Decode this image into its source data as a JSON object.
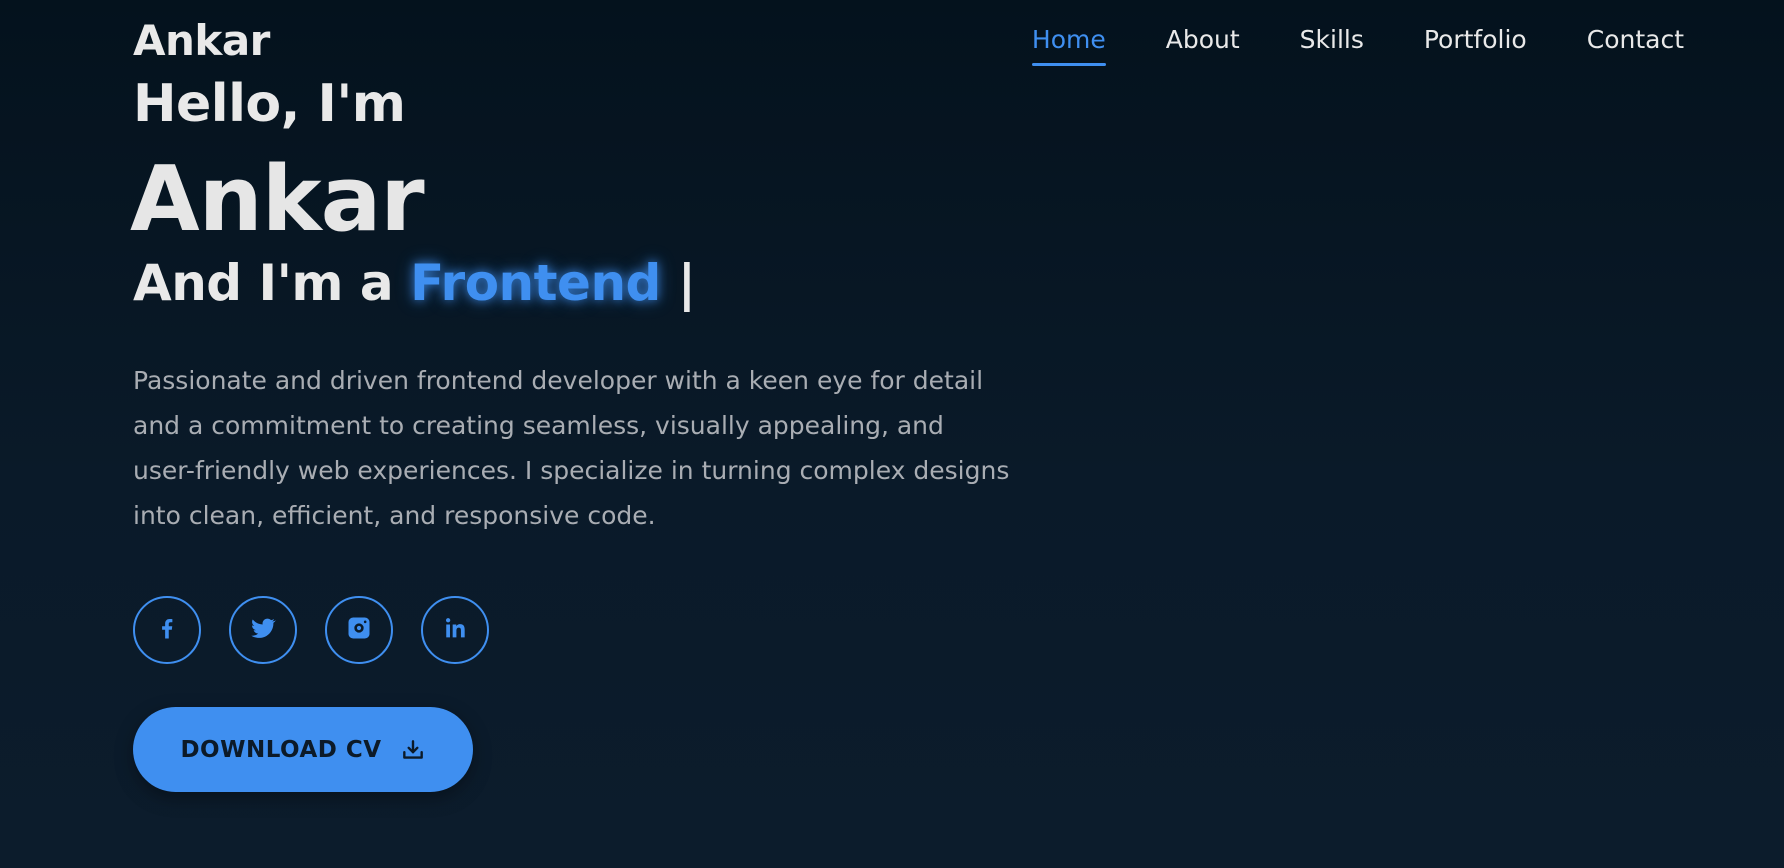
{
  "brand": "Ankar",
  "nav": {
    "items": [
      {
        "label": "Home",
        "active": true
      },
      {
        "label": "About",
        "active": false
      },
      {
        "label": "Skills",
        "active": false
      },
      {
        "label": "Portfolio",
        "active": false
      },
      {
        "label": "Contact",
        "active": false
      }
    ]
  },
  "hero": {
    "greeting": "Hello, I'm",
    "name": "Ankar",
    "role_prefix": "And I'm a",
    "role_highlight": "Frontend",
    "cursor": "|",
    "description": "Passionate and driven frontend developer with a keen eye for detail and a commitment to creating seamless, visually appealing, and user-friendly web experiences. I specialize in turning complex designs into clean, efficient, and responsive code."
  },
  "socials": [
    {
      "icon": "facebook-icon"
    },
    {
      "icon": "twitter-icon"
    },
    {
      "icon": "instagram-icon"
    },
    {
      "icon": "linkedin-icon"
    }
  ],
  "cta": {
    "label": "DOWNLOAD CV",
    "icon": "download-icon"
  },
  "colors": {
    "accent": "#3f8ff0",
    "background": "#04121d",
    "text": "#e9e9e9",
    "muted": "#a9adb3"
  }
}
